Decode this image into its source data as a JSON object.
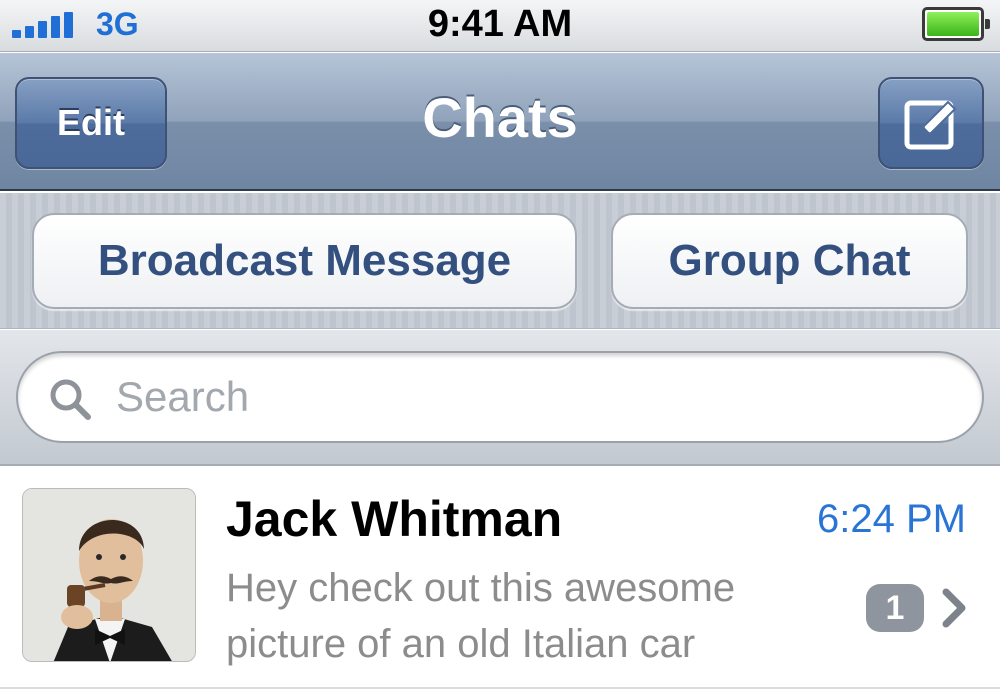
{
  "status_bar": {
    "carrier": "3G",
    "time": "9:41 AM",
    "signal_bars": 5,
    "battery_level": 1.0
  },
  "nav": {
    "title": "Chats",
    "edit_label": "Edit",
    "compose_icon": "compose-icon"
  },
  "actions": {
    "broadcast_label": "Broadcast Message",
    "group_label": "Group Chat"
  },
  "search": {
    "placeholder": "Search",
    "value": "",
    "icon": "search-icon"
  },
  "chats": [
    {
      "name": "Jack Whitman",
      "time": "6:24 PM",
      "preview": "Hey check out this awesome picture of an old Italian car",
      "unread": "1"
    }
  ],
  "colors": {
    "accent": "#1f6fd6",
    "nav_bar": "#8aa0bc",
    "button_text": "#33507f",
    "time_text": "#2a74d6",
    "badge": "#8e959e"
  }
}
